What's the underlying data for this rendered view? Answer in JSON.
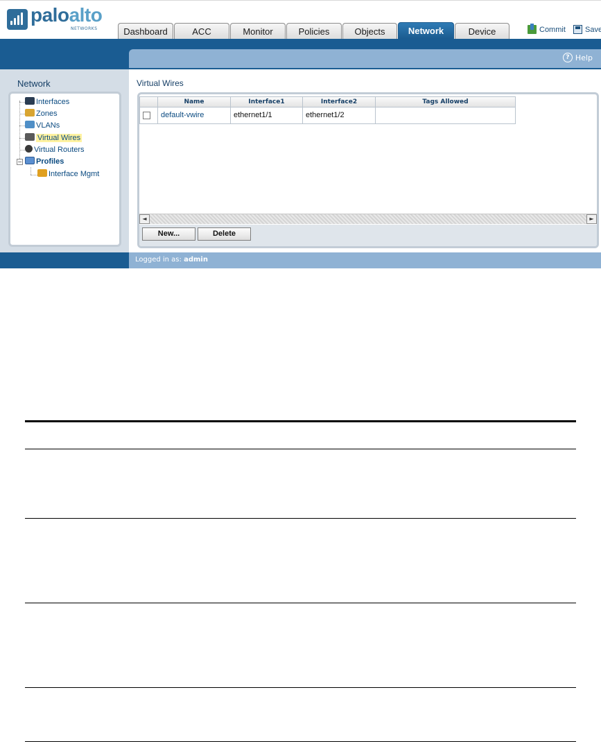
{
  "brand": {
    "word1": "palo",
    "word2": "alto",
    "sub": "NETWORKS"
  },
  "tabs": [
    {
      "label": "Dashboard",
      "active": false
    },
    {
      "label": "ACC",
      "active": false
    },
    {
      "label": "Monitor",
      "active": false
    },
    {
      "label": "Policies",
      "active": false
    },
    {
      "label": "Objects",
      "active": false
    },
    {
      "label": "Network",
      "active": true
    },
    {
      "label": "Device",
      "active": false
    }
  ],
  "actions": {
    "commit": "Commit",
    "save": "Save"
  },
  "help": {
    "label": "Help",
    "glyph": "?"
  },
  "sidebar": {
    "title": "Network",
    "items": [
      {
        "label": "Interfaces",
        "icon": "interfaces-icon"
      },
      {
        "label": "Zones",
        "icon": "zones-icon"
      },
      {
        "label": "VLANs",
        "icon": "vlans-icon"
      },
      {
        "label": "Virtual Wires",
        "icon": "virtual-wires-icon",
        "selected": true
      },
      {
        "label": "Virtual Routers",
        "icon": "virtual-routers-icon"
      },
      {
        "label": "Profiles",
        "icon": "profiles-icon",
        "expander": "−"
      },
      {
        "label": "Interface Mgmt",
        "icon": "interface-mgmt-icon"
      }
    ]
  },
  "main": {
    "title": "Virtual Wires",
    "columns": [
      "Name",
      "Interface1",
      "Interface2",
      "Tags Allowed"
    ],
    "rows": [
      {
        "name": "default-vwire",
        "interface1": "ethernet1/1",
        "interface2": "ethernet1/2",
        "tags": ""
      }
    ],
    "scroll_left": "◄",
    "scroll_right": "►",
    "buttons": {
      "new": "New...",
      "delete": "Delete"
    }
  },
  "footer": {
    "logged_in_label": "Logged in as:",
    "user": "admin"
  },
  "colors": {
    "accent": "#1a5c92",
    "header_band": "#8fb2d4",
    "link": "#0a4a80",
    "selection": "#fff2a0"
  }
}
